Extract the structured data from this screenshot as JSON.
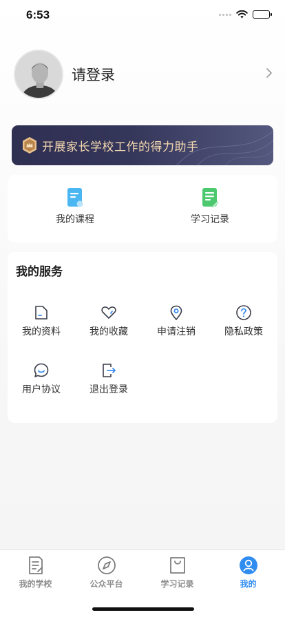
{
  "status_bar": {
    "time": "6:53"
  },
  "profile": {
    "name": "请登录"
  },
  "banner": {
    "text": "开展家长学校工作的得力助手"
  },
  "quick_actions": [
    {
      "label": "我的课程",
      "icon": "course-book-icon",
      "color": "#4ab6f2"
    },
    {
      "label": "学习记录",
      "icon": "study-record-icon",
      "color": "#4cc96e"
    }
  ],
  "services": {
    "title": "我的服务",
    "items": [
      {
        "label": "我的资料",
        "icon": "folder-icon"
      },
      {
        "label": "我的收藏",
        "icon": "heart-icon"
      },
      {
        "label": "申请注销",
        "icon": "location-pin-icon"
      },
      {
        "label": "隐私政策",
        "icon": "question-circle-icon"
      },
      {
        "label": "用户协议",
        "icon": "chat-bubble-icon"
      },
      {
        "label": "退出登录",
        "icon": "logout-icon"
      }
    ]
  },
  "tab_bar": {
    "items": [
      {
        "label": "我的学校",
        "icon": "document-icon",
        "active": false
      },
      {
        "label": "公众平台",
        "icon": "compass-icon",
        "active": false
      },
      {
        "label": "学习记录",
        "icon": "shopping-bag-icon",
        "active": false
      },
      {
        "label": "我的",
        "icon": "user-circle-icon",
        "active": true
      }
    ]
  },
  "colors": {
    "accent": "#2f8cf0",
    "banner_text": "#f3d7b0",
    "icon_stroke": "#3a3d4a",
    "icon_accent": "#3b8cf0"
  }
}
